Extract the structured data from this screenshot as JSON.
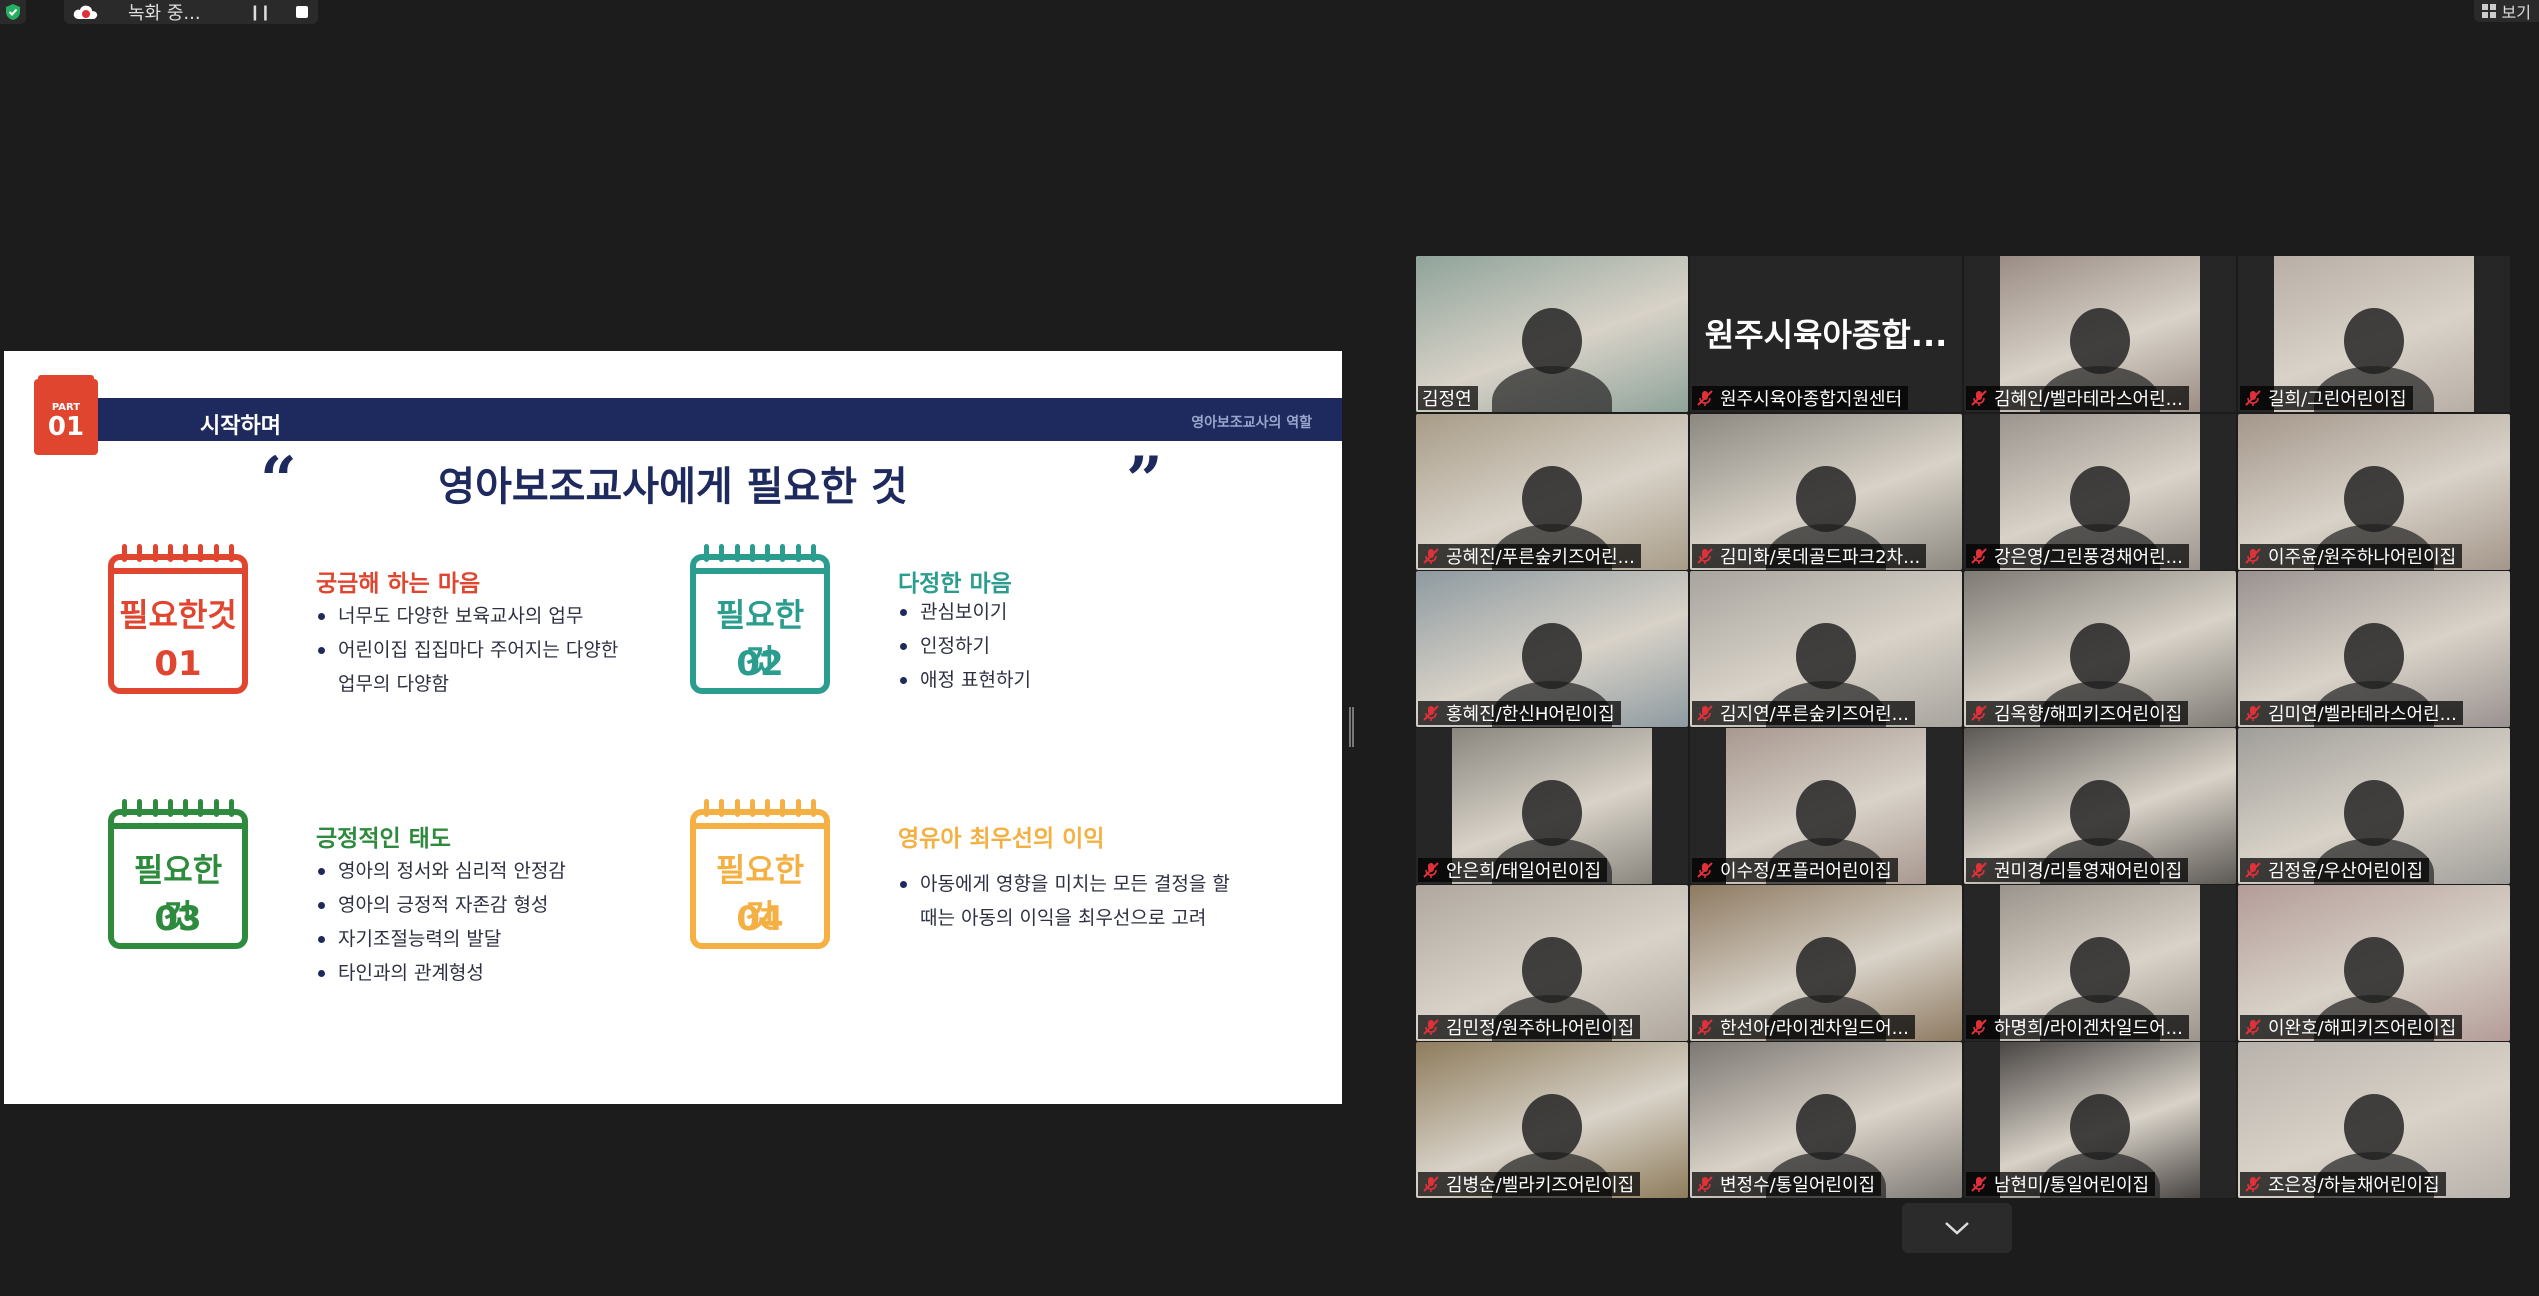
{
  "topbar": {
    "recording_label": "녹화 중...",
    "view_label": "보기"
  },
  "slide": {
    "part_label": "PART",
    "part_number": "01",
    "header_title": "시작하며",
    "header_right": "영아보조교사의 역할",
    "title": "영아보조교사에게 필요한 것",
    "cards": [
      {
        "label": "필요한것",
        "number": "01",
        "heading": "궁금해 하는 마음",
        "color": "#e0462f",
        "bullets": [
          "너무도 다양한 보육교사의 업무",
          "어린이집 집집마다 주어지는 다양한",
          "업무의 다양함"
        ]
      },
      {
        "label": "필요한 것",
        "number": "02",
        "heading": "다정한 마음",
        "color": "#2a9d8f",
        "bullets": [
          "관심보이기",
          "인정하기",
          "애정 표현하기"
        ]
      },
      {
        "label": "필요한 것",
        "number": "03",
        "heading": "긍정적인 태도",
        "color": "#2e8b3e",
        "bullets": [
          "영아의 정서와 심리적 안정감",
          "영아의 긍정적 자존감 형성",
          "자기조절능력의 발달",
          "타인과의 관계형성"
        ]
      },
      {
        "label": "필요한 것",
        "number": "04",
        "heading": "영유아 최우선의 이익",
        "color": "#f4b042",
        "bullets": [
          "아동에게 영향을 미치는 모든 결정을 할",
          "때는 아동의 이익을 최우선으로 고려"
        ]
      }
    ]
  },
  "participants": [
    {
      "name": "김정연",
      "muted": false,
      "active": true,
      "bg": "#8fa39a"
    },
    {
      "name": "원주시육아종합지원센터",
      "muted": true,
      "display_text": "원주시육아종합...",
      "bg": "#262626"
    },
    {
      "name": "김혜인/벨라테라스어린...",
      "muted": true,
      "bg": "#9a8c84"
    },
    {
      "name": "길희/그린어린이집",
      "muted": true,
      "bg": "#b8aea6"
    },
    {
      "name": "공혜진/푸른숲키즈어린...",
      "muted": true,
      "bg": "#a89c88"
    },
    {
      "name": "김미화/롯데골드파크2차...",
      "muted": true,
      "bg": "#8c8880"
    },
    {
      "name": "강은영/그린풍경채어린...",
      "muted": true,
      "bg": "#9c948e"
    },
    {
      "name": "이주윤/원주하나어린이집",
      "muted": true,
      "bg": "#a4968a"
    },
    {
      "name": "홍혜진/한신H어린이집",
      "muted": true,
      "bg": "#8e9aa0"
    },
    {
      "name": "김지연/푸른숲키즈어린...",
      "muted": true,
      "bg": "#a8a49e"
    },
    {
      "name": "김옥향/해피키즈어린이집",
      "muted": true,
      "bg": "#7e7a74"
    },
    {
      "name": "김미연/벨라테라스어린...",
      "muted": true,
      "bg": "#9a9290"
    },
    {
      "name": "안은희/태일어린이집",
      "muted": true,
      "bg": "#8a867e"
    },
    {
      "name": "이수정/포플러어린이집",
      "muted": true,
      "bg": "#a89890"
    },
    {
      "name": "권미경/리틀영재어린이집",
      "muted": true,
      "bg": "#5c5854"
    },
    {
      "name": "김정윤/우산어린이집",
      "muted": true,
      "bg": "#a09e9a"
    },
    {
      "name": "김민정/원주하나어린이집",
      "muted": true,
      "bg": "#b0a89e"
    },
    {
      "name": "한선아/라이겐차일드어...",
      "muted": true,
      "bg": "#8e7a62"
    },
    {
      "name": "하명희/라이겐차일드어...",
      "muted": true,
      "bg": "#9a948c"
    },
    {
      "name": "이완호/해피키즈어린이집",
      "muted": true,
      "bg": "#b49c98"
    },
    {
      "name": "김병순/벨라키즈어린이집",
      "muted": true,
      "bg": "#8e7c5c"
    },
    {
      "name": "변정수/통일어린이집",
      "muted": true,
      "bg": "#7e7874"
    },
    {
      "name": "남현미/통일어린이집",
      "muted": true,
      "bg": "#4a4644"
    },
    {
      "name": "조은정/하늘채어린이집",
      "muted": true,
      "bg": "#b8b2ac"
    }
  ],
  "colors": {
    "active_speaker": "#b8e03c",
    "slide_navy": "#1e2a5e",
    "mute_red": "#e0303a"
  }
}
